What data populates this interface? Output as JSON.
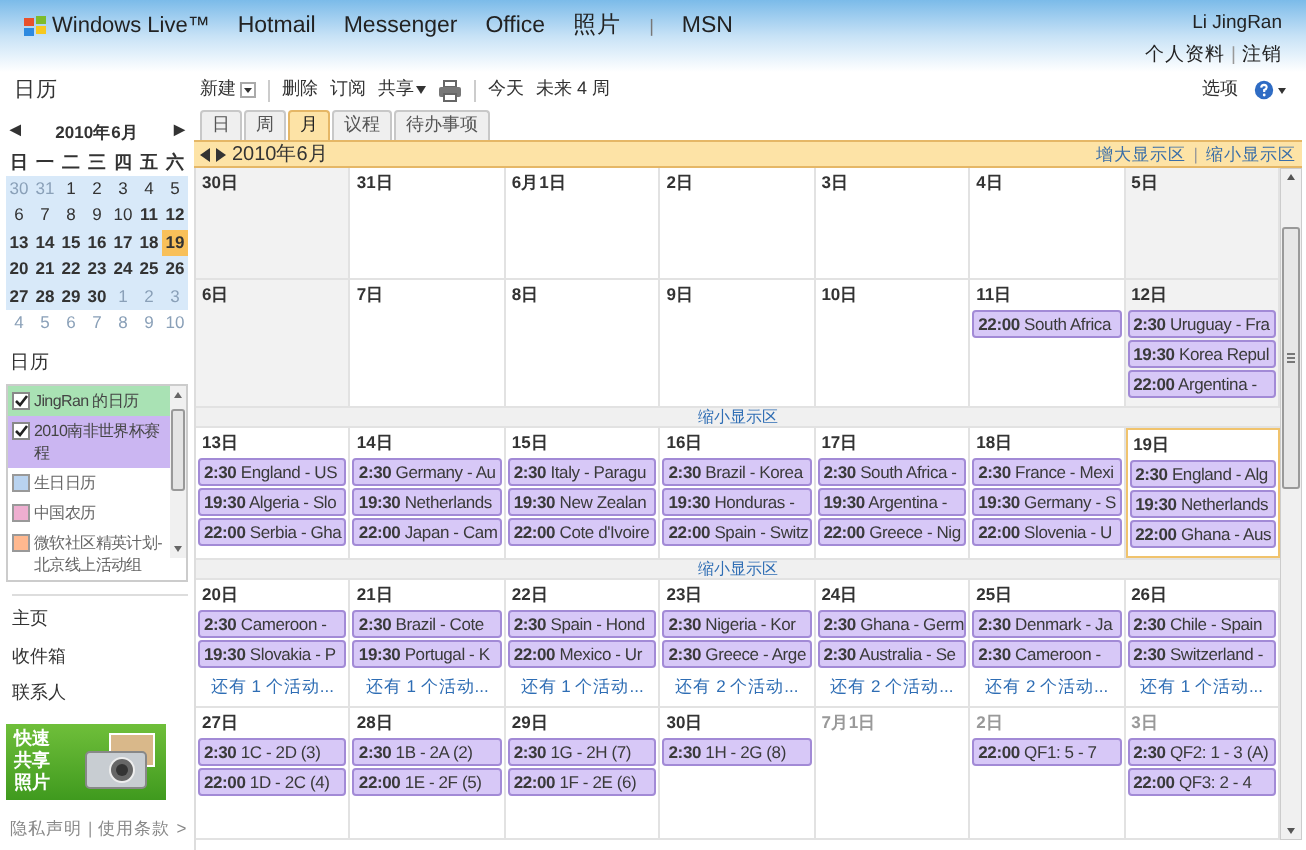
{
  "nav": {
    "logo": "Windows Live™",
    "items": [
      {
        "kind": "link",
        "label": "Hotmail"
      },
      {
        "kind": "link",
        "label": "Messenger"
      },
      {
        "kind": "link",
        "label": "Office"
      },
      {
        "kind": "link",
        "label": "照片"
      },
      {
        "kind": "separator",
        "label": "|"
      },
      {
        "kind": "link",
        "label": "MSN"
      }
    ]
  },
  "user": {
    "name": "Li JingRan",
    "links": [
      {
        "kind": "link",
        "label": "个人资料"
      },
      {
        "kind": "separator",
        "label": "|"
      },
      {
        "kind": "link",
        "label": "注销"
      }
    ]
  },
  "sidebar": {
    "title": "日历",
    "mini_calendar": {
      "prev": "◀",
      "month": "2010年6月",
      "next": "▶",
      "weekdays": [
        "日",
        "一",
        "二",
        "三",
        "四",
        "五",
        "六"
      ],
      "days": [
        {
          "label": "30",
          "bold": false,
          "other_month": true,
          "in_range": true,
          "selected": false
        },
        {
          "label": "31",
          "bold": false,
          "other_month": true,
          "in_range": true,
          "selected": false
        },
        {
          "label": "1",
          "bold": false,
          "other_month": false,
          "in_range": true,
          "selected": false
        },
        {
          "label": "2",
          "bold": false,
          "other_month": false,
          "in_range": true,
          "selected": false
        },
        {
          "label": "3",
          "bold": false,
          "other_month": false,
          "in_range": true,
          "selected": false
        },
        {
          "label": "4",
          "bold": false,
          "other_month": false,
          "in_range": true,
          "selected": false
        },
        {
          "label": "5",
          "bold": false,
          "other_month": false,
          "in_range": true,
          "selected": false
        },
        {
          "label": "6",
          "bold": false,
          "other_month": false,
          "in_range": true,
          "selected": false
        },
        {
          "label": "7",
          "bold": false,
          "other_month": false,
          "in_range": true,
          "selected": false
        },
        {
          "label": "8",
          "bold": false,
          "other_month": false,
          "in_range": true,
          "selected": false
        },
        {
          "label": "9",
          "bold": false,
          "other_month": false,
          "in_range": true,
          "selected": false
        },
        {
          "label": "10",
          "bold": false,
          "other_month": false,
          "in_range": true,
          "selected": false
        },
        {
          "label": "11",
          "bold": true,
          "other_month": false,
          "in_range": true,
          "selected": false
        },
        {
          "label": "12",
          "bold": true,
          "other_month": false,
          "in_range": true,
          "selected": false
        },
        {
          "label": "13",
          "bold": true,
          "other_month": false,
          "in_range": true,
          "selected": false
        },
        {
          "label": "14",
          "bold": true,
          "other_month": false,
          "in_range": true,
          "selected": false
        },
        {
          "label": "15",
          "bold": true,
          "other_month": false,
          "in_range": true,
          "selected": false
        },
        {
          "label": "16",
          "bold": true,
          "other_month": false,
          "in_range": true,
          "selected": false
        },
        {
          "label": "17",
          "bold": true,
          "other_month": false,
          "in_range": true,
          "selected": false
        },
        {
          "label": "18",
          "bold": true,
          "other_month": false,
          "in_range": true,
          "selected": false
        },
        {
          "label": "19",
          "bold": true,
          "other_month": false,
          "in_range": true,
          "selected": true
        },
        {
          "label": "20",
          "bold": true,
          "other_month": false,
          "in_range": true,
          "selected": false
        },
        {
          "label": "21",
          "bold": true,
          "other_month": false,
          "in_range": true,
          "selected": false
        },
        {
          "label": "22",
          "bold": true,
          "other_month": false,
          "in_range": true,
          "selected": false
        },
        {
          "label": "23",
          "bold": true,
          "other_month": false,
          "in_range": true,
          "selected": false
        },
        {
          "label": "24",
          "bold": true,
          "other_month": false,
          "in_range": true,
          "selected": false
        },
        {
          "label": "25",
          "bold": true,
          "other_month": false,
          "in_range": true,
          "selected": false
        },
        {
          "label": "26",
          "bold": true,
          "other_month": false,
          "in_range": true,
          "selected": false
        },
        {
          "label": "27",
          "bold": true,
          "other_month": false,
          "in_range": true,
          "selected": false
        },
        {
          "label": "28",
          "bold": true,
          "other_month": false,
          "in_range": true,
          "selected": false
        },
        {
          "label": "29",
          "bold": true,
          "other_month": false,
          "in_range": true,
          "selected": false
        },
        {
          "label": "30",
          "bold": true,
          "other_month": false,
          "in_range": true,
          "selected": false
        },
        {
          "label": "1",
          "bold": false,
          "other_month": true,
          "in_range": true,
          "selected": false
        },
        {
          "label": "2",
          "bold": false,
          "other_month": true,
          "in_range": true,
          "selected": false
        },
        {
          "label": "3",
          "bold": false,
          "other_month": true,
          "in_range": true,
          "selected": false
        },
        {
          "label": "4",
          "bold": false,
          "other_month": true,
          "in_range": false,
          "selected": false
        },
        {
          "label": "5",
          "bold": false,
          "other_month": true,
          "in_range": false,
          "selected": false
        },
        {
          "label": "6",
          "bold": false,
          "other_month": true,
          "in_range": false,
          "selected": false
        },
        {
          "label": "7",
          "bold": false,
          "other_month": true,
          "in_range": false,
          "selected": false
        },
        {
          "label": "8",
          "bold": false,
          "other_month": true,
          "in_range": false,
          "selected": false
        },
        {
          "label": "9",
          "bold": false,
          "other_month": true,
          "in_range": false,
          "selected": false
        },
        {
          "label": "10",
          "bold": false,
          "other_month": true,
          "in_range": false,
          "selected": false
        }
      ]
    },
    "calendars_title": "日历",
    "calendars": [
      {
        "label": "JingRan 的日历",
        "checked": true,
        "color": "#a9e2b4"
      },
      {
        "label": "2010南非世界杯赛程",
        "checked": true,
        "color": "#cbb6f2"
      },
      {
        "label": "生日日历",
        "checked": false,
        "color": "#b9d3f0"
      },
      {
        "label": "中国农历",
        "checked": false,
        "color": "#eeaed0"
      },
      {
        "label": "微软社区精英计划-北京线上活动组",
        "checked": false,
        "color": "#ffb88f"
      }
    ],
    "links": [
      "主页",
      "收件箱",
      "联系人"
    ],
    "promo": {
      "lines": [
        "快速",
        "共享",
        "照片"
      ]
    },
    "footer": [
      {
        "kind": "link",
        "label": "隐私声明"
      },
      {
        "kind": "separator",
        "label": "|"
      },
      {
        "kind": "link",
        "label": "使用条款"
      },
      {
        "kind": "arrow",
        "label": ">"
      }
    ]
  },
  "toolbar": {
    "items": [
      {
        "kind": "dropdown",
        "label": "新建"
      },
      {
        "kind": "divider"
      },
      {
        "kind": "button",
        "label": "删除"
      },
      {
        "kind": "button",
        "label": "订阅"
      },
      {
        "kind": "menu",
        "label": "共享"
      },
      {
        "kind": "print"
      },
      {
        "kind": "divider"
      },
      {
        "kind": "button",
        "label": "今天"
      },
      {
        "kind": "button",
        "label": "未来 4 周"
      }
    ],
    "options": "选项"
  },
  "tabs": [
    {
      "label": "日",
      "selected": false
    },
    {
      "label": "周",
      "selected": false
    },
    {
      "label": "月",
      "selected": true
    },
    {
      "label": "议程",
      "selected": false
    },
    {
      "label": "待办事项",
      "selected": false
    }
  ],
  "month_bar": {
    "title": "2010年6月",
    "links": [
      {
        "kind": "link",
        "label": "增大显示区"
      },
      {
        "kind": "separator",
        "label": "|"
      },
      {
        "kind": "link",
        "label": "缩小显示区"
      }
    ]
  },
  "weeks": [
    {
      "days": [
        {
          "label": "30日",
          "shaded": true,
          "other_month": false,
          "today": false
        },
        {
          "label": "31日",
          "shaded": false,
          "other_month": false,
          "today": false
        },
        {
          "label": "6月1日",
          "shaded": false,
          "other_month": false,
          "today": false
        },
        {
          "label": "2日",
          "shaded": false,
          "other_month": false,
          "today": false
        },
        {
          "label": "3日",
          "shaded": false,
          "other_month": false,
          "today": false
        },
        {
          "label": "4日",
          "shaded": false,
          "other_month": false,
          "today": false
        },
        {
          "label": "5日",
          "shaded": true,
          "other_month": false,
          "today": false
        }
      ]
    },
    {
      "days": [
        {
          "label": "6日",
          "shaded": true,
          "other_month": false,
          "today": false
        },
        {
          "label": "7日",
          "shaded": false,
          "other_month": false,
          "today": false
        },
        {
          "label": "8日",
          "shaded": false,
          "other_month": false,
          "today": false
        },
        {
          "label": "9日",
          "shaded": false,
          "other_month": false,
          "today": false
        },
        {
          "label": "10日",
          "shaded": false,
          "other_month": false,
          "today": false
        },
        {
          "label": "11日",
          "shaded": false,
          "other_month": false,
          "today": false,
          "events": [
            {
              "time": "22:00",
              "title": "South Africa"
            }
          ]
        },
        {
          "label": "12日",
          "shaded": true,
          "other_month": false,
          "today": false,
          "events": [
            {
              "time": "2:30",
              "title": "Uruguay - Fra"
            },
            {
              "time": "19:30",
              "title": "Korea Repul"
            },
            {
              "time": "22:00",
              "title": "Argentina -"
            }
          ]
        }
      ],
      "link": "缩小显示区"
    },
    {
      "days": [
        {
          "label": "13日",
          "shaded": false,
          "other_month": false,
          "today": false,
          "events": [
            {
              "time": "2:30",
              "title": "England - US"
            },
            {
              "time": "19:30",
              "title": "Algeria - Slo"
            },
            {
              "time": "22:00",
              "title": "Serbia - Gha"
            }
          ]
        },
        {
          "label": "14日",
          "shaded": false,
          "other_month": false,
          "today": false,
          "events": [
            {
              "time": "2:30",
              "title": "Germany - Au"
            },
            {
              "time": "19:30",
              "title": "Netherlands"
            },
            {
              "time": "22:00",
              "title": "Japan - Cam"
            }
          ]
        },
        {
          "label": "15日",
          "shaded": false,
          "other_month": false,
          "today": false,
          "events": [
            {
              "time": "2:30",
              "title": "Italy - Paragu"
            },
            {
              "time": "19:30",
              "title": "New Zealan"
            },
            {
              "time": "22:00",
              "title": "Cote d'Ivoire"
            }
          ]
        },
        {
          "label": "16日",
          "shaded": false,
          "other_month": false,
          "today": false,
          "events": [
            {
              "time": "2:30",
              "title": "Brazil - Korea"
            },
            {
              "time": "19:30",
              "title": "Honduras -"
            },
            {
              "time": "22:00",
              "title": "Spain - Switz"
            }
          ]
        },
        {
          "label": "17日",
          "shaded": false,
          "other_month": false,
          "today": false,
          "events": [
            {
              "time": "2:30",
              "title": "South Africa -"
            },
            {
              "time": "19:30",
              "title": "Argentina -"
            },
            {
              "time": "22:00",
              "title": "Greece - Nig"
            }
          ]
        },
        {
          "label": "18日",
          "shaded": false,
          "other_month": false,
          "today": false,
          "events": [
            {
              "time": "2:30",
              "title": "France - Mexi"
            },
            {
              "time": "19:30",
              "title": "Germany - S"
            },
            {
              "time": "22:00",
              "title": "Slovenia - U"
            }
          ]
        },
        {
          "label": "19日",
          "shaded": false,
          "other_month": false,
          "today": true,
          "events": [
            {
              "time": "2:30",
              "title": "England - Alg"
            },
            {
              "time": "19:30",
              "title": "Netherlands"
            },
            {
              "time": "22:00",
              "title": "Ghana - Aus"
            }
          ]
        }
      ],
      "link": "缩小显示区"
    },
    {
      "days": [
        {
          "label": "20日",
          "shaded": false,
          "other_month": false,
          "today": false,
          "events": [
            {
              "time": "2:30",
              "title": "Cameroon -"
            },
            {
              "time": "19:30",
              "title": "Slovakia - P"
            }
          ],
          "more": "还有 1 个活动..."
        },
        {
          "label": "21日",
          "shaded": false,
          "other_month": false,
          "today": false,
          "events": [
            {
              "time": "2:30",
              "title": "Brazil - Cote"
            },
            {
              "time": "19:30",
              "title": "Portugal - K"
            }
          ],
          "more": "还有 1 个活动..."
        },
        {
          "label": "22日",
          "shaded": false,
          "other_month": false,
          "today": false,
          "events": [
            {
              "time": "2:30",
              "title": "Spain - Hond"
            },
            {
              "time": "22:00",
              "title": "Mexico - Ur"
            }
          ],
          "more": "还有 1 个活动..."
        },
        {
          "label": "23日",
          "shaded": false,
          "other_month": false,
          "today": false,
          "events": [
            {
              "time": "2:30",
              "title": "Nigeria - Kor"
            },
            {
              "time": "2:30",
              "title": "Greece - Arge"
            }
          ],
          "more": "还有 2 个活动..."
        },
        {
          "label": "24日",
          "shaded": false,
          "other_month": false,
          "today": false,
          "events": [
            {
              "time": "2:30",
              "title": "Ghana - Germ"
            },
            {
              "time": "2:30",
              "title": "Australia - Se"
            }
          ],
          "more": "还有 2 个活动..."
        },
        {
          "label": "25日",
          "shaded": false,
          "other_month": false,
          "today": false,
          "events": [
            {
              "time": "2:30",
              "title": "Denmark - Ja"
            },
            {
              "time": "2:30",
              "title": "Cameroon -"
            }
          ],
          "more": "还有 2 个活动..."
        },
        {
          "label": "26日",
          "shaded": false,
          "other_month": false,
          "today": false,
          "events": [
            {
              "time": "2:30",
              "title": "Chile - Spain"
            },
            {
              "time": "2:30",
              "title": "Switzerland -"
            }
          ],
          "more": "还有 1 个活动..."
        }
      ]
    },
    {
      "days": [
        {
          "label": "27日",
          "shaded": false,
          "other_month": false,
          "today": false,
          "events": [
            {
              "time": "2:30",
              "title": "1C - 2D (3)"
            },
            {
              "time": "22:00",
              "title": "1D - 2C (4)"
            }
          ]
        },
        {
          "label": "28日",
          "shaded": false,
          "other_month": false,
          "today": false,
          "events": [
            {
              "time": "2:30",
              "title": "1B - 2A (2)"
            },
            {
              "time": "22:00",
              "title": "1E - 2F (5)"
            }
          ]
        },
        {
          "label": "29日",
          "shaded": false,
          "other_month": false,
          "today": false,
          "events": [
            {
              "time": "2:30",
              "title": "1G - 2H (7)"
            },
            {
              "time": "22:00",
              "title": "1F - 2E (6)"
            }
          ]
        },
        {
          "label": "30日",
          "shaded": false,
          "other_month": false,
          "today": false,
          "events": [
            {
              "time": "2:30",
              "title": "1H - 2G (8)"
            }
          ]
        },
        {
          "label": "7月1日",
          "shaded": false,
          "other_month": true,
          "today": false
        },
        {
          "label": "2日",
          "shaded": false,
          "other_month": true,
          "today": false,
          "events": [
            {
              "time": "22:00",
              "title": "QF1: 5 - 7"
            }
          ]
        },
        {
          "label": "3日",
          "shaded": false,
          "other_month": true,
          "today": false,
          "events": [
            {
              "time": "2:30",
              "title": "QF2: 1 - 3 (A)"
            },
            {
              "time": "22:00",
              "title": "QF3: 2 - 4"
            }
          ]
        }
      ]
    }
  ]
}
